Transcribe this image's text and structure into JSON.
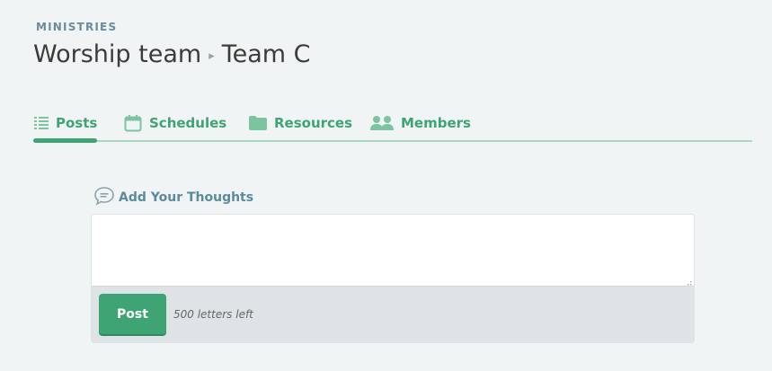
{
  "header": {
    "eyebrow": "MINISTRIES",
    "title_parent": "Worship team",
    "title_separator": "▸",
    "title_current": "Team C"
  },
  "tabs": [
    {
      "label": "Posts",
      "icon": "list-icon",
      "active": true
    },
    {
      "label": "Schedules",
      "icon": "calendar-icon",
      "active": false
    },
    {
      "label": "Resources",
      "icon": "folder-icon",
      "active": false
    },
    {
      "label": "Members",
      "icon": "people-icon",
      "active": false
    }
  ],
  "composer": {
    "label": "Add Your Thoughts",
    "label_icon": "speech-bubble-icon",
    "value": "",
    "post_label": "Post",
    "counter_text": "500 letters left"
  },
  "colors": {
    "accent": "#3ea474",
    "tab_underline": "#a9d7c1",
    "label_blue": "#5b8b9b",
    "background": "#f1f4f5"
  }
}
